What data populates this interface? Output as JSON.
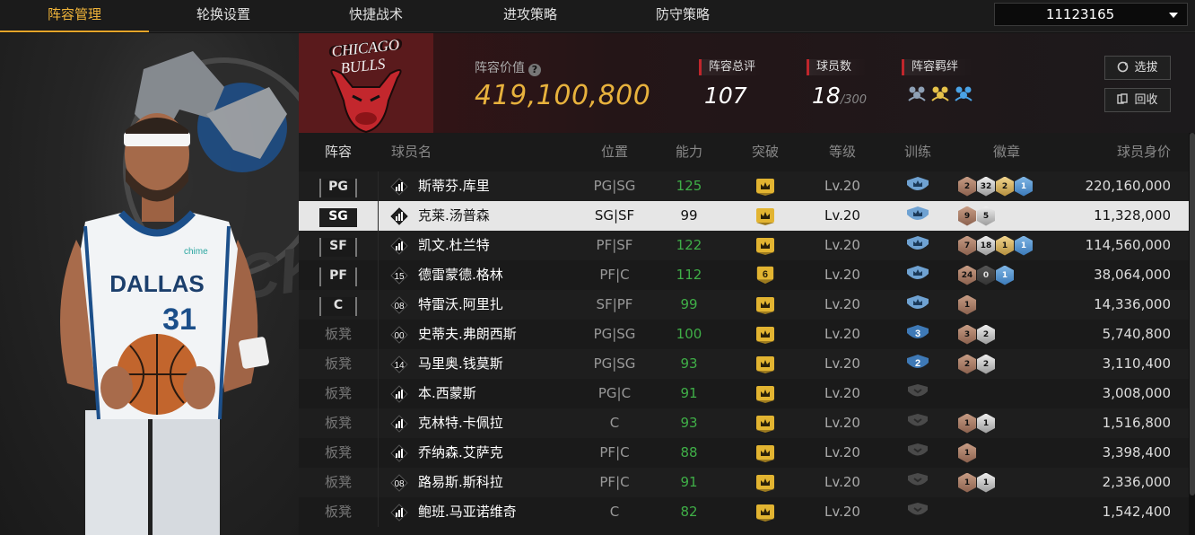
{
  "nav": {
    "tabs": [
      {
        "label": "阵容管理",
        "active": true
      },
      {
        "label": "轮换设置",
        "active": false
      },
      {
        "label": "快捷战术",
        "active": false
      },
      {
        "label": "进攻策略",
        "active": false
      },
      {
        "label": "防守策略",
        "active": false
      }
    ],
    "team_id": "11123165"
  },
  "player_card": {
    "jersey_team": "DALLAS",
    "jersey_number": "31",
    "sponsor": "chime"
  },
  "summary": {
    "logo_text": "CHICAGO BULLS",
    "value_label": "阵容价值",
    "value": "419,100,800",
    "rating_label": "阵容总评",
    "rating": "107",
    "players_label": "球员数",
    "players": "18",
    "players_max": "/300",
    "bonds_label": "阵容羁绊",
    "buttons": {
      "scout": "选拔",
      "recycle": "回收"
    }
  },
  "table": {
    "headers": {
      "slot": "阵容",
      "name": "球员名",
      "positions": "位置",
      "ability": "能力",
      "breakthrough": "突破",
      "level": "等级",
      "training": "训练",
      "badges": "徽章",
      "price": "球员身价"
    },
    "rows": [
      {
        "slot": "PG",
        "bench": false,
        "tier": "bars",
        "name": "斯蒂芬.库里",
        "positions": "PG|SG",
        "ability": "125",
        "ability_color": "green",
        "break": "crown",
        "level": "Lv.20",
        "train": "shield-blue",
        "badges": [
          {
            "t": "bronze",
            "n": "2"
          },
          {
            "t": "silver",
            "n": "32"
          },
          {
            "t": "gold",
            "n": "2"
          },
          {
            "t": "blue",
            "n": "1"
          }
        ],
        "price": "220,160,000",
        "selected": false
      },
      {
        "slot": "SG",
        "bench": false,
        "tier": "bars",
        "name": "克莱.汤普森",
        "positions": "SG|SF",
        "ability": "99",
        "ability_color": "white",
        "break": "crown",
        "level": "Lv.20",
        "train": "shield-blue",
        "badges": [
          {
            "t": "bronze",
            "n": "9"
          },
          {
            "t": "silver",
            "n": "5"
          }
        ],
        "price": "11,328,000",
        "selected": true
      },
      {
        "slot": "SF",
        "bench": false,
        "tier": "bars",
        "name": "凯文.杜兰特",
        "positions": "PF|SF",
        "ability": "122",
        "ability_color": "green",
        "break": "crown",
        "level": "Lv.20",
        "train": "shield-blue",
        "badges": [
          {
            "t": "bronze",
            "n": "7"
          },
          {
            "t": "silver",
            "n": "18"
          },
          {
            "t": "gold",
            "n": "1"
          },
          {
            "t": "blue",
            "n": "1"
          }
        ],
        "price": "114,560,000",
        "selected": false
      },
      {
        "slot": "PF",
        "bench": false,
        "tier": "15",
        "name": "德雷蒙德.格林",
        "positions": "PF|C",
        "ability": "112",
        "ability_color": "green",
        "break": "6",
        "level": "Lv.20",
        "train": "shield-blue",
        "badges": [
          {
            "t": "bronze",
            "n": "24"
          },
          {
            "t": "dark",
            "n": "0"
          },
          {
            "t": "blue",
            "n": "1"
          }
        ],
        "price": "38,064,000",
        "selected": false
      },
      {
        "slot": "C",
        "bench": false,
        "tier": "08",
        "name": "特雷沃.阿里扎",
        "positions": "SF|PF",
        "ability": "99",
        "ability_color": "green",
        "break": "crown",
        "level": "Lv.20",
        "train": "shield-blue",
        "badges": [
          {
            "t": "bronze",
            "n": "1"
          }
        ],
        "price": "14,336,000",
        "selected": false
      },
      {
        "slot": "板凳",
        "bench": true,
        "tier": "00",
        "name": "史蒂夫.弗朗西斯",
        "positions": "PG|SG",
        "ability": "100",
        "ability_color": "green",
        "break": "crown",
        "level": "Lv.20",
        "train": "shield-3",
        "badges": [
          {
            "t": "bronze",
            "n": "3"
          },
          {
            "t": "silver",
            "n": "2"
          }
        ],
        "price": "5,740,800",
        "selected": false
      },
      {
        "slot": "板凳",
        "bench": true,
        "tier": "14",
        "name": "马里奥.钱莫斯",
        "positions": "PG|SG",
        "ability": "93",
        "ability_color": "green",
        "break": "crown",
        "level": "Lv.20",
        "train": "shield-2",
        "badges": [
          {
            "t": "bronze",
            "n": "2"
          },
          {
            "t": "silver",
            "n": "2"
          }
        ],
        "price": "3,110,400",
        "selected": false
      },
      {
        "slot": "板凳",
        "bench": true,
        "tier": "bars",
        "name": "本.西蒙斯",
        "positions": "PG|C",
        "ability": "91",
        "ability_color": "green",
        "break": "crown",
        "level": "Lv.20",
        "train": "shield-gray",
        "badges": [],
        "price": "3,008,000",
        "selected": false
      },
      {
        "slot": "板凳",
        "bench": true,
        "tier": "bars",
        "name": "克林特.卡佩拉",
        "positions": "C",
        "ability": "93",
        "ability_color": "green",
        "break": "crown",
        "level": "Lv.20",
        "train": "shield-gray",
        "badges": [
          {
            "t": "bronze",
            "n": "1"
          },
          {
            "t": "silver",
            "n": "1"
          }
        ],
        "price": "1,516,800",
        "selected": false
      },
      {
        "slot": "板凳",
        "bench": true,
        "tier": "bars",
        "name": "乔纳森.艾萨克",
        "positions": "PF|C",
        "ability": "88",
        "ability_color": "green",
        "break": "crown",
        "level": "Lv.20",
        "train": "shield-gray",
        "badges": [
          {
            "t": "bronze",
            "n": "1"
          }
        ],
        "price": "3,398,400",
        "selected": false
      },
      {
        "slot": "板凳",
        "bench": true,
        "tier": "08",
        "name": "路易斯.斯科拉",
        "positions": "PF|C",
        "ability": "91",
        "ability_color": "green",
        "break": "crown",
        "level": "Lv.20",
        "train": "shield-gray",
        "badges": [
          {
            "t": "bronze",
            "n": "1"
          },
          {
            "t": "silver",
            "n": "1"
          }
        ],
        "price": "2,336,000",
        "selected": false
      },
      {
        "slot": "板凳",
        "bench": true,
        "tier": "bars",
        "name": "鲍班.马亚诺维奇",
        "positions": "C",
        "ability": "82",
        "ability_color": "green",
        "break": "crown",
        "level": "Lv.20",
        "train": "shield-gray",
        "badges": [],
        "price": "1,542,400",
        "selected": false
      }
    ]
  }
}
